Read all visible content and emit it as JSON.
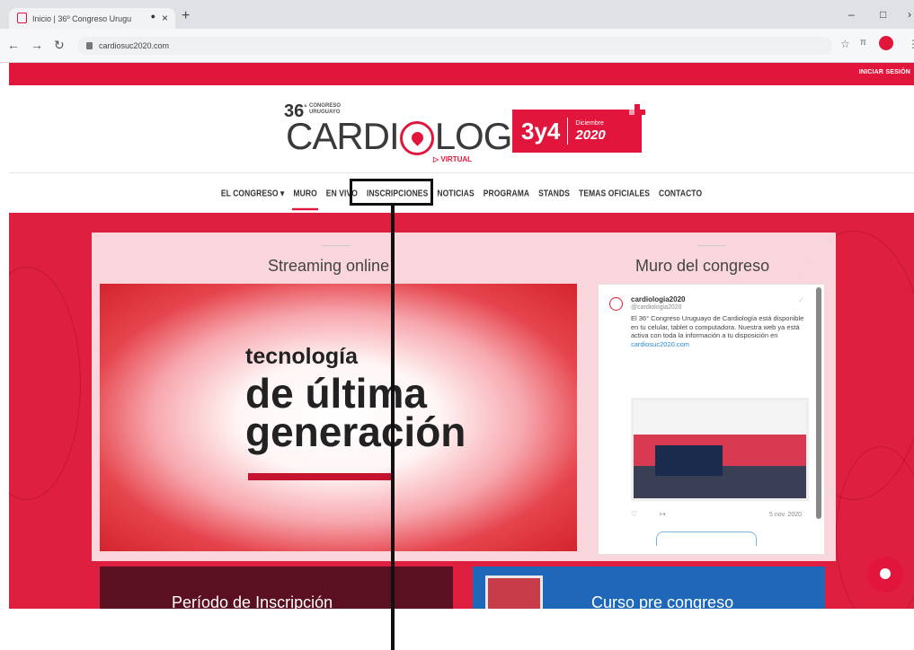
{
  "browser": {
    "tab_title": "Inicio | 36º Congreso Urugu",
    "url": "cardiosuc2020.com"
  },
  "site": {
    "login": "INICIAR SESIÓN",
    "logo_number": "36",
    "logo_sup": "°",
    "logo_small": "CONGRESO URUGUAYO",
    "logo_left": "CARDI",
    "logo_right": "LOGÍA",
    "logo_virtual": "VIRTUAL",
    "date_days": "3y4",
    "date_month": "Diciembre",
    "date_year": "2020",
    "menu": [
      "EL CONGRESO ▾",
      "MURO",
      "EN VIVO",
      "INSCRIPCIONES",
      "NOTICIAS",
      "PROGRAMA",
      "STANDS",
      "TEMAS OFICIALES",
      "CONTACTO"
    ]
  },
  "streaming": {
    "title": "Streaming online",
    "line1": "tecnología",
    "line2": "de última",
    "line3": "generación"
  },
  "wall": {
    "title": "Muro del congreso",
    "tweet_name": "cardiologia2020",
    "tweet_handle": "@cardiologia2020",
    "tweet_text": "El 36° Congreso Uruguayo de Cardiología está disponible en tu celular, tablet o computadora. Nuestra web ya está activa con toda la información a tu disposición en",
    "tweet_link": "cardiosuc2020.com",
    "tweet_date": "5 nov. 2020"
  },
  "cards": {
    "left": "Período de Inscripción",
    "right": "Curso pre congreso"
  }
}
